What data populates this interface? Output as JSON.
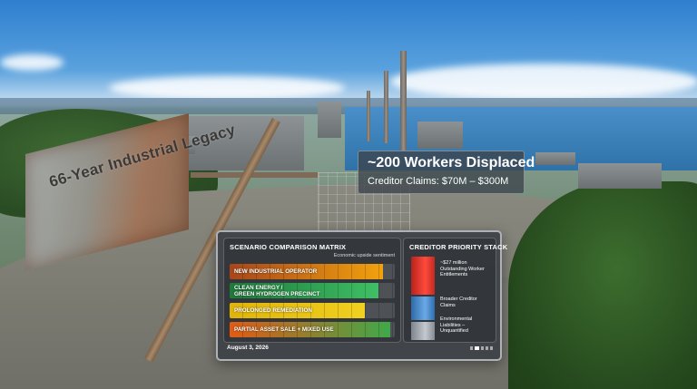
{
  "scene": {
    "wall_sign": "66-Year Industrial Legacy"
  },
  "headline": {
    "title": "~200 Workers Displaced",
    "subtitle": "Creditor Claims: $70M – $300M"
  },
  "matrix": {
    "title": "SCENARIO COMPARISON MATRIX",
    "sublabel": "Economic upside sentiment",
    "bars": [
      {
        "label_lines": [
          "NEW INDUSTRIAL OPERATOR"
        ],
        "value": 0.93,
        "color_start": "#a8461a",
        "color_end": "#f2a20e"
      },
      {
        "label_lines": [
          "CLEAN ENERGY /",
          "GREEN HYDROGEN PRECINCT"
        ],
        "value": 0.9,
        "color_start": "#1d7a3a",
        "color_end": "#3fc065"
      },
      {
        "label_lines": [
          "PROLONGED REMEDIATION"
        ],
        "value": 0.82,
        "color_start": "#e0b40a",
        "color_end": "#f0d020"
      },
      {
        "label_lines": [
          "PARTIAL ASSET SALE + MIXED USE"
        ],
        "value": 0.97,
        "color_start": "#e25a14",
        "color_end": "#3fa84a"
      }
    ],
    "date": "August 3, 2026"
  },
  "priority": {
    "title": "CREDITOR PRIORITY STACK",
    "levels": [
      {
        "label_lines": [
          "~$27 million",
          "Outstanding Worker",
          "Entitlements"
        ],
        "color": "#e23a30"
      },
      {
        "label_lines": [
          "Broader Creditor",
          "Claims"
        ],
        "color": "#3a7fc4"
      },
      {
        "label_lines": [
          "Environmental",
          "Liabilities –",
          "Unquantified"
        ],
        "color": "#9aa0a8"
      }
    ]
  }
}
